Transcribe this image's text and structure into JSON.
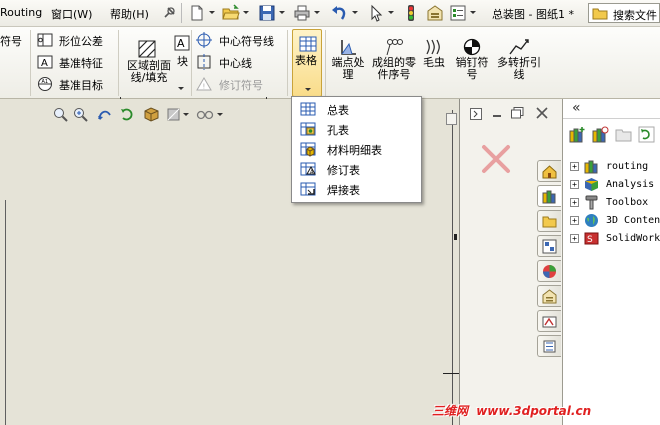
{
  "menubar": {
    "items": [
      "Routing",
      "窗口(W)",
      "帮助(H)"
    ],
    "document_title": "总装图 - 图纸1 *",
    "search_placeholder": "搜索文件"
  },
  "ribbon": {
    "annotation_small": [
      "符号",
      "形位公差",
      "基准特征",
      "基准目标"
    ],
    "area_hatch_label": "区域剖面线/填充",
    "block_label": "块",
    "centermark": [
      "中心符号线",
      "中心线",
      "修订符号"
    ],
    "table_label": "表格",
    "large_buttons": [
      "端点处理",
      "成组的零件序号",
      "毛虫",
      "销钉符号",
      "多转折引线"
    ]
  },
  "table_dropdown": {
    "items": [
      "总表",
      "孔表",
      "材料明细表",
      "修订表",
      "焊接表"
    ]
  },
  "task_pane": {
    "collapse_glyph": "«",
    "tree": [
      "routing",
      "Analysis",
      "Toolbox",
      "3D Conten",
      "SolidWork"
    ]
  },
  "watermark": {
    "part1": "三维网",
    "part2": "www.3dportal.cn"
  },
  "colors": {
    "watermark_red": "#e02020",
    "dropdown_bg": "#ffffff",
    "drawing_bg": "#e5e3d7"
  }
}
